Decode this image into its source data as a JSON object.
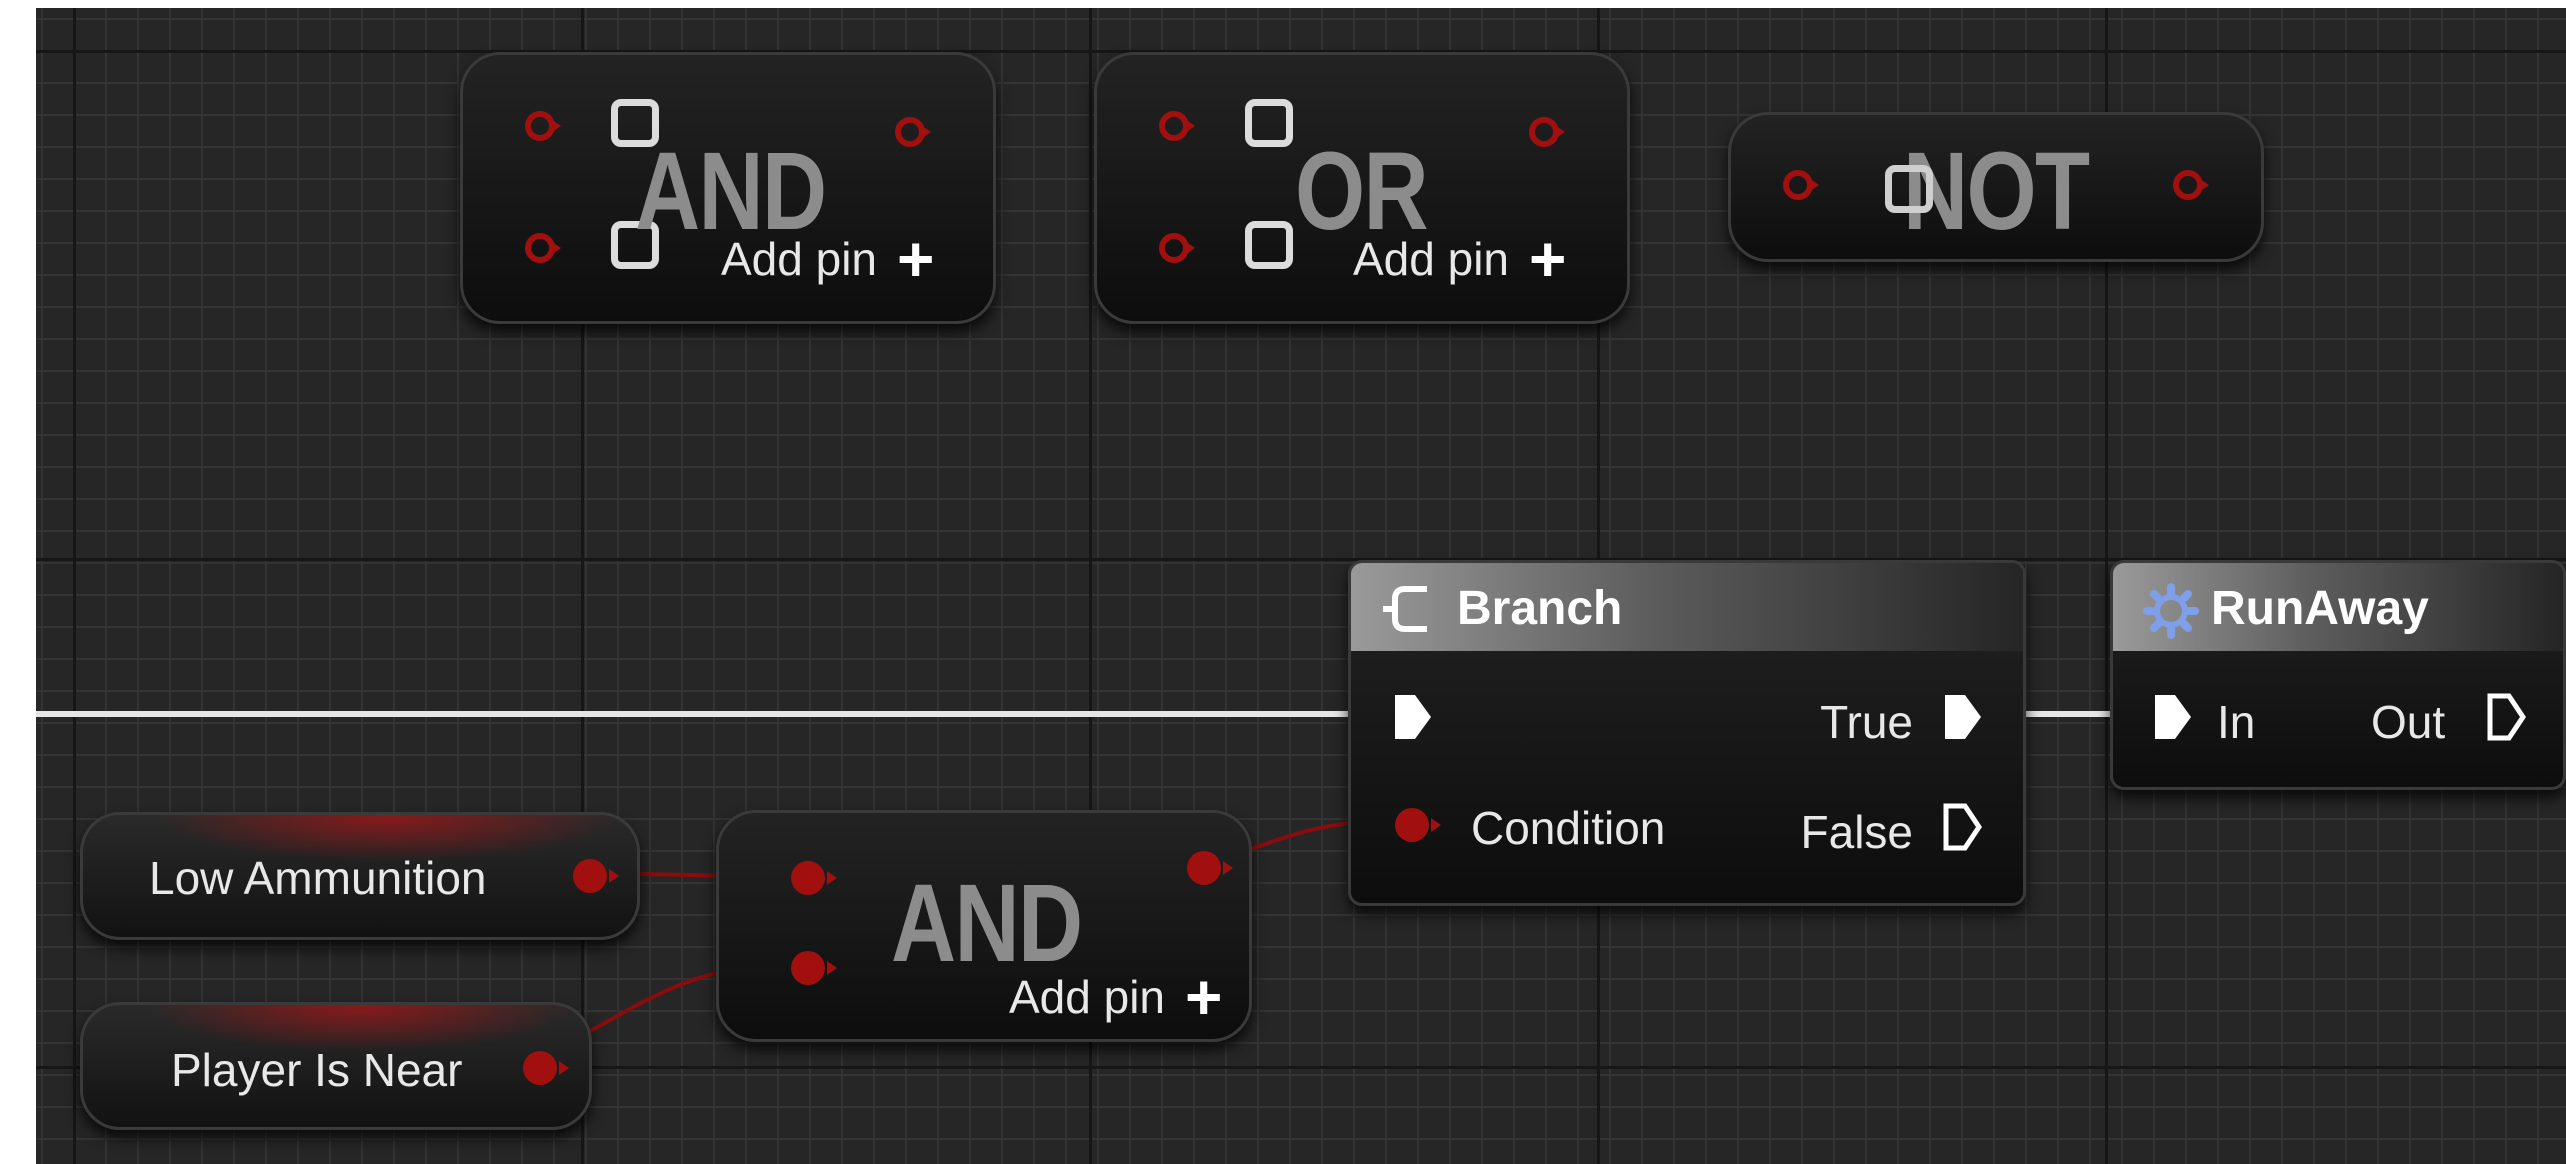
{
  "nodes": {
    "and_top": {
      "label": "AND",
      "add_pin_label": "Add pin"
    },
    "or_top": {
      "label": "OR",
      "add_pin_label": "Add pin"
    },
    "not_top": {
      "label": "NOT"
    },
    "branch": {
      "title": "Branch",
      "icon": "branch-icon",
      "outputs": {
        "true_label": "True",
        "false_label": "False"
      },
      "inputs": {
        "condition_label": "Condition"
      }
    },
    "runaway": {
      "title": "RunAway",
      "icon": "gear-icon",
      "in_label": "In",
      "out_label": "Out"
    },
    "and_bottom": {
      "label": "AND",
      "add_pin_label": "Add pin"
    },
    "low_ammunition": {
      "label": "Low Ammunition"
    },
    "player_is_near": {
      "label": "Player Is Near"
    }
  },
  "colors": {
    "grid_background": "#262626",
    "boolean_pin": "#a10f0f",
    "exec_wire": "#e6e6e6",
    "title_bar_gradient": "#9a9a9a"
  }
}
